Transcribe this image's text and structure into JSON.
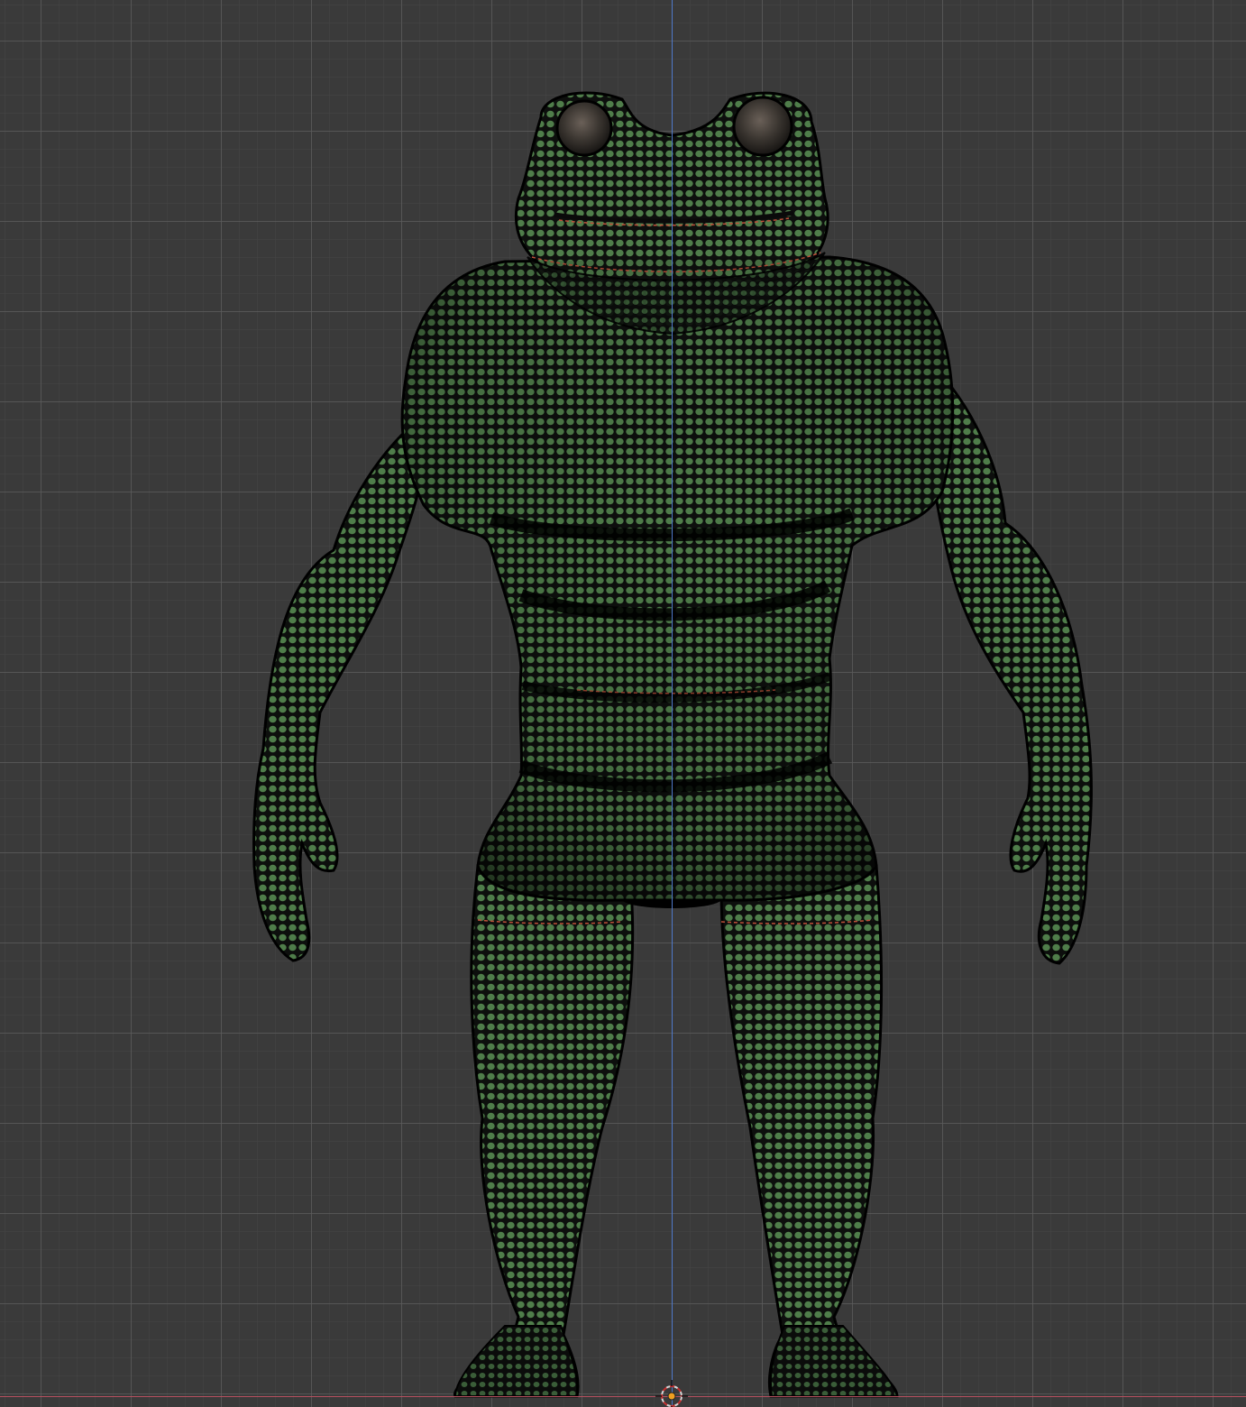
{
  "viewport": {
    "background_color": "#3a3a3a",
    "grid_color": "#5c5c5c",
    "axis_z_color": "#4f78c9",
    "axis_x_color": "#b5505f"
  },
  "model": {
    "subject": "frog-character-mesh",
    "mesh_color": "#4f7d4a",
    "wire_color": "#0d0f0d",
    "eye_color": "#3a3530",
    "seam_color": "#c0503a"
  },
  "icons": {
    "origin": "origin-point-icon",
    "cursor": "3d-cursor-icon"
  }
}
